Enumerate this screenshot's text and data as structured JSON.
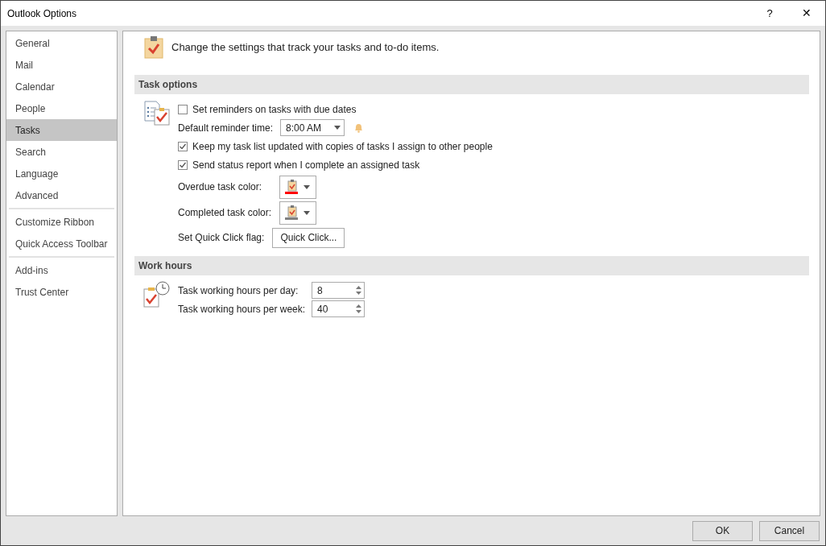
{
  "window": {
    "title": "Outlook Options",
    "help": "?",
    "close": "✕"
  },
  "sidebar": {
    "groups": [
      [
        {
          "label": "General",
          "selected": false
        },
        {
          "label": "Mail",
          "selected": false
        },
        {
          "label": "Calendar",
          "selected": false
        },
        {
          "label": "People",
          "selected": false
        },
        {
          "label": "Tasks",
          "selected": true
        },
        {
          "label": "Search",
          "selected": false
        },
        {
          "label": "Language",
          "selected": false
        },
        {
          "label": "Advanced",
          "selected": false
        }
      ],
      [
        {
          "label": "Customize Ribbon",
          "selected": false
        },
        {
          "label": "Quick Access Toolbar",
          "selected": false
        }
      ],
      [
        {
          "label": "Add-ins",
          "selected": false
        },
        {
          "label": "Trust Center",
          "selected": false
        }
      ]
    ]
  },
  "header": {
    "text": "Change the settings that track your tasks and to-do items."
  },
  "sections": [
    {
      "title": "Task options",
      "rows": [
        {
          "kind": "checkbox",
          "label": "Set reminders on tasks with due dates",
          "checked": false
        },
        {
          "kind": "dropdown",
          "label": "Default reminder time:",
          "value": "8:00 AM"
        },
        {
          "kind": "checkbox",
          "label": "Keep my task list updated with copies of tasks I assign to other people",
          "checked": true
        },
        {
          "kind": "checkbox",
          "label": "Send status report when I complete an assigned task",
          "checked": true
        },
        {
          "kind": "color",
          "label": "Overdue task color:",
          "color": "#ff0000"
        },
        {
          "kind": "color",
          "label": "Completed task color:",
          "color": "#808080"
        },
        {
          "kind": "button",
          "label": "Set Quick Click flag:",
          "value": "Quick Click..."
        }
      ]
    },
    {
      "title": "Work hours",
      "rows": [
        {
          "kind": "spinner",
          "label": "Task working hours per day:",
          "value": "8"
        },
        {
          "kind": "spinner",
          "label": "Task working hours per week:",
          "value": "40"
        }
      ]
    }
  ],
  "buttons": [
    {
      "label": "OK"
    },
    {
      "label": "Cancel"
    }
  ]
}
